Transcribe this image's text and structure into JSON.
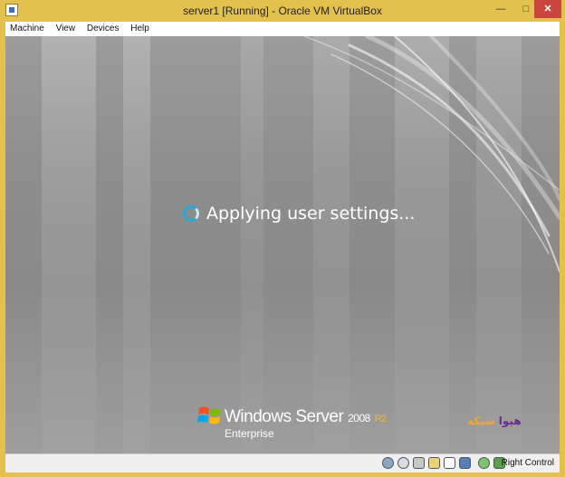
{
  "window": {
    "title": "server1 [Running] - Oracle VM VirtualBox"
  },
  "menubar": {
    "items": [
      "Machine",
      "View",
      "Devices",
      "Help"
    ]
  },
  "guest": {
    "status_text": "Applying user settings...",
    "brand_name": "Windows Server",
    "brand_version": "2008",
    "brand_release": "R2",
    "brand_edition": "Enterprise",
    "watermark_a": "هیوا",
    "watermark_b": "شبکه"
  },
  "statusbar": {
    "host_key": "Right Control",
    "icons": [
      "hard-disk-icon",
      "optical-drive-icon",
      "usb-icon",
      "shared-folders-icon",
      "display-icon",
      "capture-icon",
      "network-icon",
      "mouse-integration-icon"
    ]
  },
  "colors": {
    "titlebar": "#e3c14f",
    "spinner": "#2aa8d6",
    "close": "#c9453e",
    "release": "#f3b43a"
  }
}
